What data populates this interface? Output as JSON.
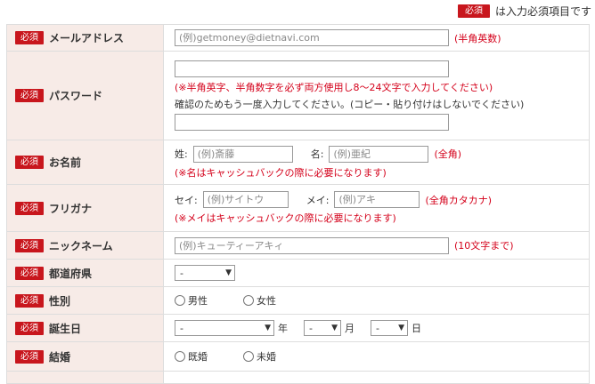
{
  "legend": {
    "badge": "必須",
    "text": "は入力必須項目です"
  },
  "required_badge": "必須",
  "email": {
    "label": "メールアドレス",
    "placeholder": "(例)getmoney@dietnavi.com",
    "note": "(半角英数)"
  },
  "password": {
    "label": "パスワード",
    "note": "(※半角英字、半角数字を必ず両方使用し8～24文字で入力してください)",
    "confirm_hint": "確認のためもう一度入力してください。(コピー・貼り付けはしないでください)"
  },
  "name": {
    "label": "お名前",
    "last_label": "姓:",
    "last_placeholder": "(例)斎藤",
    "first_label": "名:",
    "first_placeholder": "(例)亜紀",
    "note": "(全角)",
    "sub_note": "(※名はキャッシュバックの際に必要になります)"
  },
  "furigana": {
    "label": "フリガナ",
    "last_label": "セイ:",
    "last_placeholder": "(例)サイトウ",
    "first_label": "メイ:",
    "first_placeholder": "(例)アキ",
    "note": "(全角カタカナ)",
    "sub_note": "(※メイはキャッシュバックの際に必要になります)"
  },
  "nickname": {
    "label": "ニックネーム",
    "placeholder": "(例)キューティーアキィ",
    "note": "(10文字まで)"
  },
  "prefecture": {
    "label": "都道府県",
    "selected": "-"
  },
  "gender": {
    "label": "性別",
    "options": [
      "男性",
      "女性"
    ]
  },
  "birthday": {
    "label": "誕生日",
    "year_selected": "-",
    "year_unit": "年",
    "month_selected": "-",
    "month_unit": "月",
    "day_selected": "-",
    "day_unit": "日"
  },
  "marriage": {
    "label": "結婚",
    "options": [
      "既婚",
      "未婚"
    ]
  }
}
